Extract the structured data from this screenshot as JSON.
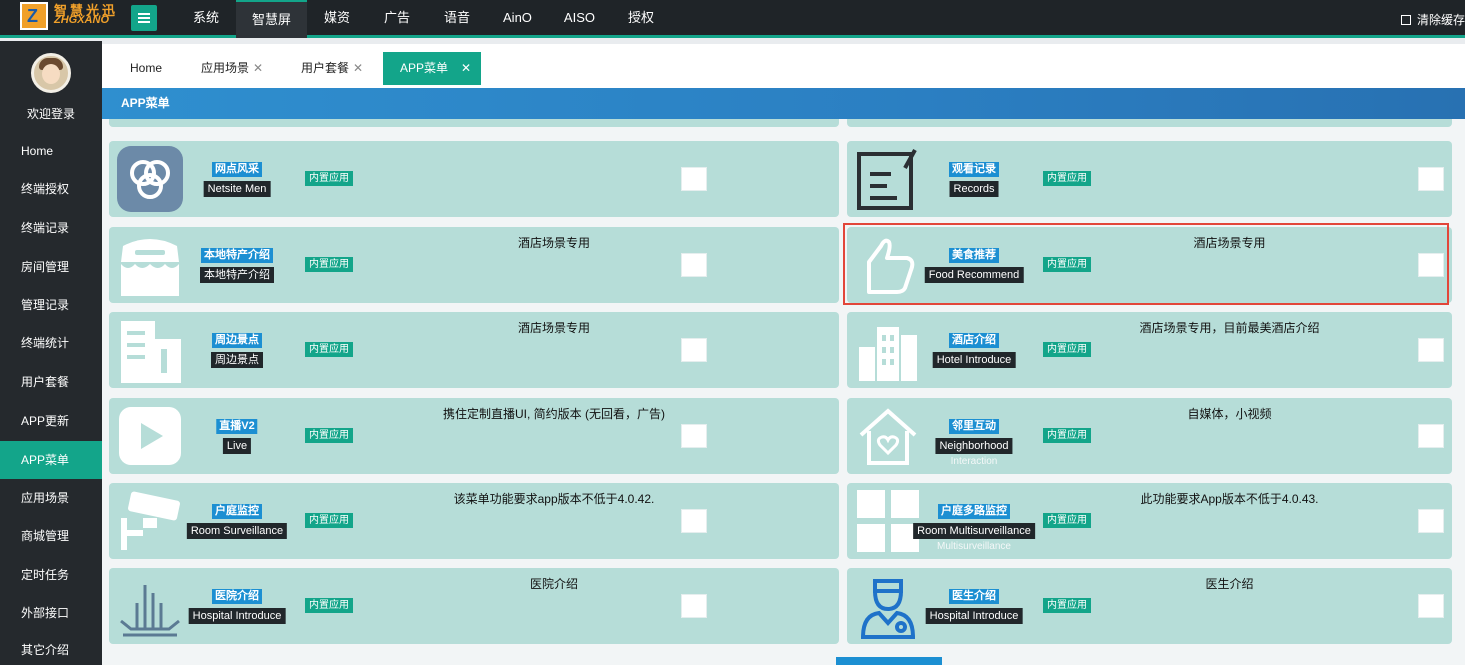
{
  "brand": {
    "logo_mark": "Z",
    "name_cn": "智慧光迅",
    "name_en": "ZHGXANO"
  },
  "topnav": [
    "系统",
    "智慧屏",
    "媒资",
    "广告",
    "语音",
    "AinO",
    "AISO",
    "授权"
  ],
  "topnav_active": "智慧屏",
  "clear_cache": "清除缓存",
  "sidebar": {
    "welcome": "欢迎登录",
    "items": [
      "Home",
      "终端授权",
      "终端记录",
      "房间管理",
      "管理记录",
      "终端统计",
      "用户套餐",
      "APP更新",
      "APP菜单",
      "应用场景",
      "商城管理",
      "定时任务",
      "外部接口",
      "其它介绍"
    ],
    "active": "APP菜单"
  },
  "tabs": [
    {
      "label": "Home",
      "closable": false
    },
    {
      "label": "应用场景",
      "closable": true
    },
    {
      "label": "用户套餐",
      "closable": true
    },
    {
      "label": "APP菜单",
      "closable": true,
      "active": true
    }
  ],
  "panel_title": "APP菜单",
  "builtin_label": "内置应用",
  "cards": [
    {
      "icon": "netsite-icon",
      "tag_top": "网点风采",
      "tag_bot": "Netsite Men",
      "desc": ""
    },
    {
      "icon": "records-icon",
      "tag_top": "观看记录",
      "tag_bot": "Records",
      "desc": ""
    },
    {
      "icon": "store-icon",
      "tag_top": "本地特产介绍",
      "tag_bot": "本地特产介绍",
      "desc": "酒店场景专用"
    },
    {
      "icon": "thumbs-up-icon",
      "tag_top": "美食推荐",
      "tag_bot": "Food Recommend",
      "desc": "酒店场景专用"
    },
    {
      "icon": "building-icon",
      "tag_top": "周边景点",
      "tag_bot": "周边景点",
      "desc": "酒店场景专用"
    },
    {
      "icon": "hotel-icon",
      "tag_top": "酒店介绍",
      "tag_bot": "Hotel Introduce",
      "desc": "酒店场景专用，目前最美酒店介绍"
    },
    {
      "icon": "play-icon",
      "tag_top": "直播V2",
      "tag_bot": "Live",
      "desc": "携住定制直播UI, 简约版本 (无回看，广告)"
    },
    {
      "icon": "house-heart-icon",
      "tag_top": "邻里互动",
      "tag_bot": "Neighborhood",
      "tag_extra": "Interaction",
      "desc": "自媒体，小视频"
    },
    {
      "icon": "camera-icon",
      "tag_top": "户庭监控",
      "tag_bot": "Room Surveillance",
      "desc": "该菜单功能要求app版本不低于4.0.42."
    },
    {
      "icon": "grid-icon",
      "tag_top": "户庭多路监控",
      "tag_bot": "Room Multisurveillance",
      "tag_extra": "Multisurveillance",
      "desc": "此功能要求App版本不低于4.0.43."
    },
    {
      "icon": "hospital-icon",
      "tag_top": "医院介绍",
      "tag_bot": "Hospital Introduce",
      "desc": "医院介绍"
    },
    {
      "icon": "doctor-icon",
      "tag_top": "医生介绍",
      "tag_bot": "Hospital Introduce",
      "desc": "医生介绍"
    }
  ],
  "colors": {
    "accent": "#13a58a",
    "topbar": "#1f2428",
    "sidebar": "#25292d",
    "card_bg": "#b6ddd8",
    "tag_blue": "#1c8fd2",
    "header_blue": "#2b7fc2",
    "highlight": "#e2463a"
  }
}
